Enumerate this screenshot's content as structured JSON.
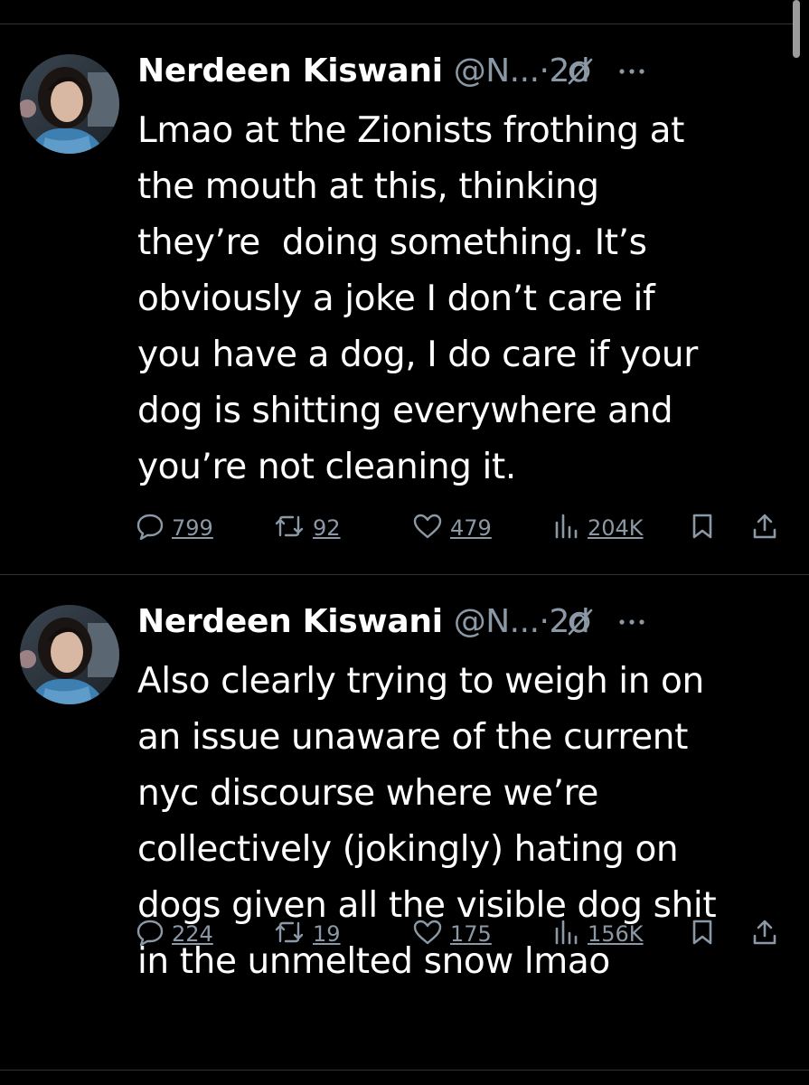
{
  "colors": {
    "background": "#000000",
    "text_primary": "#ffffff",
    "text_secondary": "#8b98a5",
    "divider": "#2f3336"
  },
  "tweets": [
    {
      "name": "Nerdeen Kiswani",
      "handle": "@N...",
      "time": "·2d",
      "text": "Lmao at the Zionists frothing at\nthe mouth at this, thinking\nthey’re  doing something. It’s\nobviously a joke I don’t care if\nyou have a dog, I do care if your\ndog is shitting everywhere and\nyou’re not cleaning it.",
      "replies": "799",
      "retweets": "92",
      "likes": "479",
      "views": "204K",
      "icons": [
        "grok-icon",
        "more-icon",
        "reply-icon",
        "retweet-icon",
        "like-icon",
        "views-icon",
        "bookmark-icon",
        "share-icon"
      ]
    },
    {
      "name": "Nerdeen Kiswani",
      "handle": "@N...",
      "time": "·2d",
      "text": "Also clearly trying to weigh in on\nan issue unaware of the current\nnyc discourse where we’re\ncollectively (jokingly) hating on\ndogs given all the visible dog shit\nin the unmelted snow lmao",
      "replies": "224",
      "retweets": "19",
      "likes": "175",
      "views": "156K",
      "icons": [
        "grok-icon",
        "more-icon",
        "reply-icon",
        "retweet-icon",
        "like-icon",
        "views-icon",
        "bookmark-icon",
        "share-icon"
      ]
    }
  ]
}
